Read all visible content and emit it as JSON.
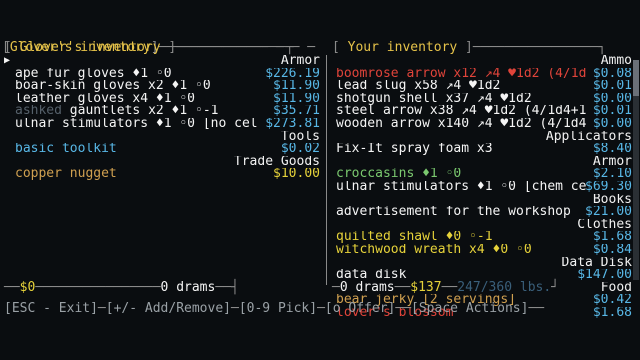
{
  "left_panel": {
    "title": "Glover's inventory",
    "categories": [
      {
        "name": "Armor",
        "items": [
          {
            "text": "ape fur gloves ♦1 ◦0",
            "price": "$226.19"
          },
          {
            "text": "boar-skin gloves x2 ♦1 ◦0",
            "price": "$11.90"
          },
          {
            "text": "leather gloves x4 ♦1 ◦0",
            "price": "$11.90"
          },
          {
            "text": "gauntlets x2 ♦1 ◦-1",
            "price": "$35.71"
          },
          {
            "text": "ulnar stimulators ♦1 ◦0 [no cel",
            "price": "$273.81"
          }
        ]
      },
      {
        "name": "Tools",
        "items": [
          {
            "text": "basic toolkit",
            "price": "$0.02"
          }
        ]
      },
      {
        "name": "Trade Goods",
        "items": [
          {
            "text": "copper nugget",
            "price": "$10.00"
          }
        ]
      }
    ],
    "money": "$0",
    "drams": "0 drams"
  },
  "right_panel": {
    "title": "Your inventory",
    "categories": [
      {
        "name": "Ammo",
        "items": [
          {
            "text": "boomrose arrow x12 ↗4 ♥1d2 (4/1d",
            "price": "$0.08"
          },
          {
            "text": "lead slug x58 ↗4 ♥1d2",
            "price": "$0.01"
          },
          {
            "text": "shotgun shell x37 ↗4 ♥1d2",
            "price": "$0.00"
          },
          {
            "text": "steel arrow x38 ↗4 ♥1d2 (4/1d4+1",
            "price": "$0.01"
          },
          {
            "text": "wooden arrow x140 ↗4 ♥1d2 (4/1d4",
            "price": "$0.00"
          }
        ]
      },
      {
        "name": "Applicators",
        "items": [
          {
            "text": "Fix-It spray foam x3",
            "price": "$8.40"
          }
        ]
      },
      {
        "name": "Armor",
        "items": [
          {
            "text": "croccasins ♦1 ◦0",
            "price": "$2.10"
          },
          {
            "text": "ulnar stimulators ♦1 ◦0 [chem ce",
            "price": "$69.30"
          }
        ]
      },
      {
        "name": "Books",
        "items": [
          {
            "text": "advertisement for the workshop",
            "price": "$21.00"
          }
        ]
      },
      {
        "name": "Clothes",
        "items": [
          {
            "text": "quilted shawl ♦0 ◦-1",
            "price": "$1.68"
          },
          {
            "text": "witchwood wreath x4 ♦0 ◦0",
            "price": "$0.84"
          }
        ]
      },
      {
        "name": "Data Disk",
        "items": [
          {
            "text": "data disk",
            "price": "$147.00"
          }
        ]
      },
      {
        "name": "Food",
        "items": [
          {
            "text": "bear jerky [2 servings]",
            "price": "$0.42"
          },
          {
            "text": "lover's blossom",
            "price": "$1.68"
          }
        ]
      }
    ],
    "drams": "0 drams",
    "money": "$137",
    "weight": "247/360 lbs."
  },
  "footer": {
    "exit": "[ESC - Exit]",
    "add_remove": "[+/- Add/Remove]",
    "pick": "[0-9 Pick]",
    "offer": "[o Offer]",
    "actions": "[Space Actions]"
  },
  "colors": {
    "background": "#0a0d10",
    "frame": "#8a8a8a",
    "title": "#e6c34a",
    "price": "#58b7e6",
    "money_yellow": "#e6d23a"
  }
}
